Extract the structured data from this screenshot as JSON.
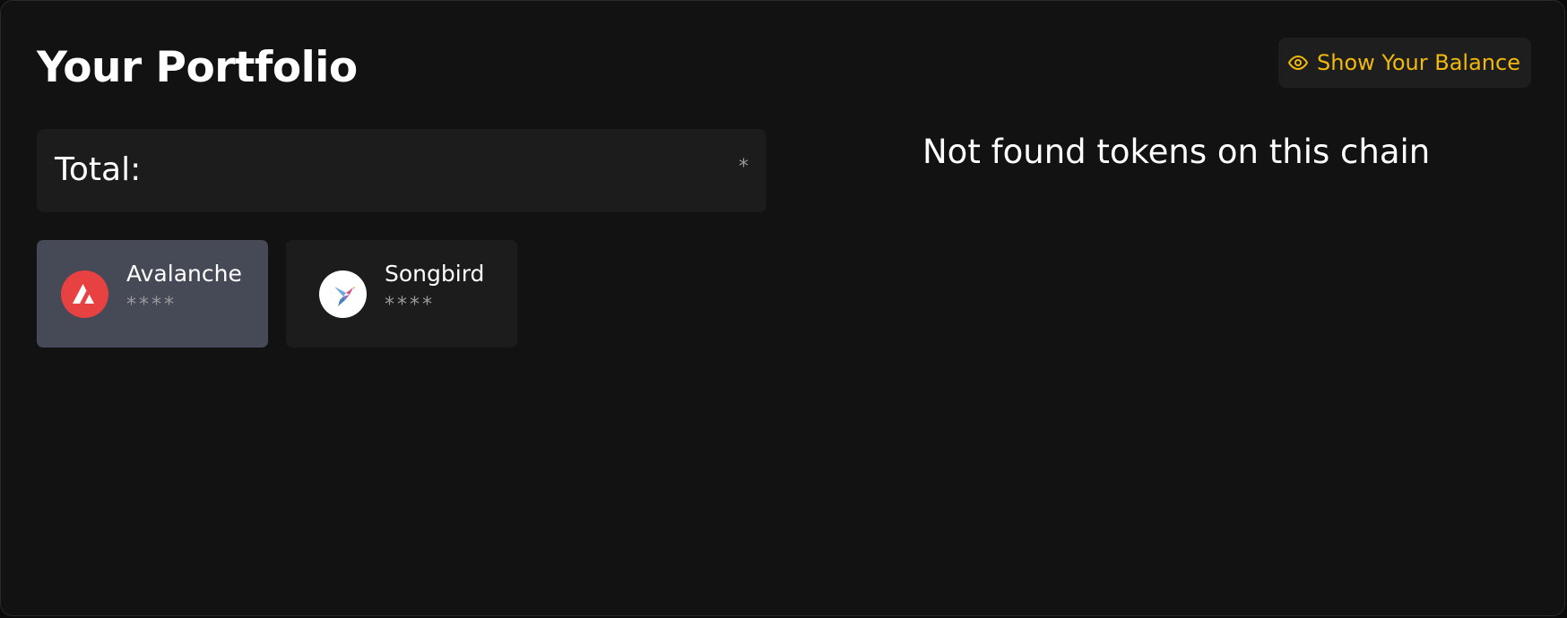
{
  "portfolio": {
    "title": "Your Portfolio",
    "show_balance_label": "Show Your Balance",
    "show_balance_icon": "eye-icon",
    "accent_color": "#f0b90b",
    "total": {
      "label": "Total:",
      "value": "*"
    },
    "chains": [
      {
        "name": "Avalanche",
        "balance": "****",
        "icon": "avalanche-logo-icon",
        "selected": true,
        "color": "#e84142"
      },
      {
        "name": "Songbird",
        "balance": "****",
        "icon": "songbird-logo-icon",
        "selected": false,
        "color": "#ffffff"
      }
    ],
    "empty_message": "Not found tokens on this chain"
  }
}
